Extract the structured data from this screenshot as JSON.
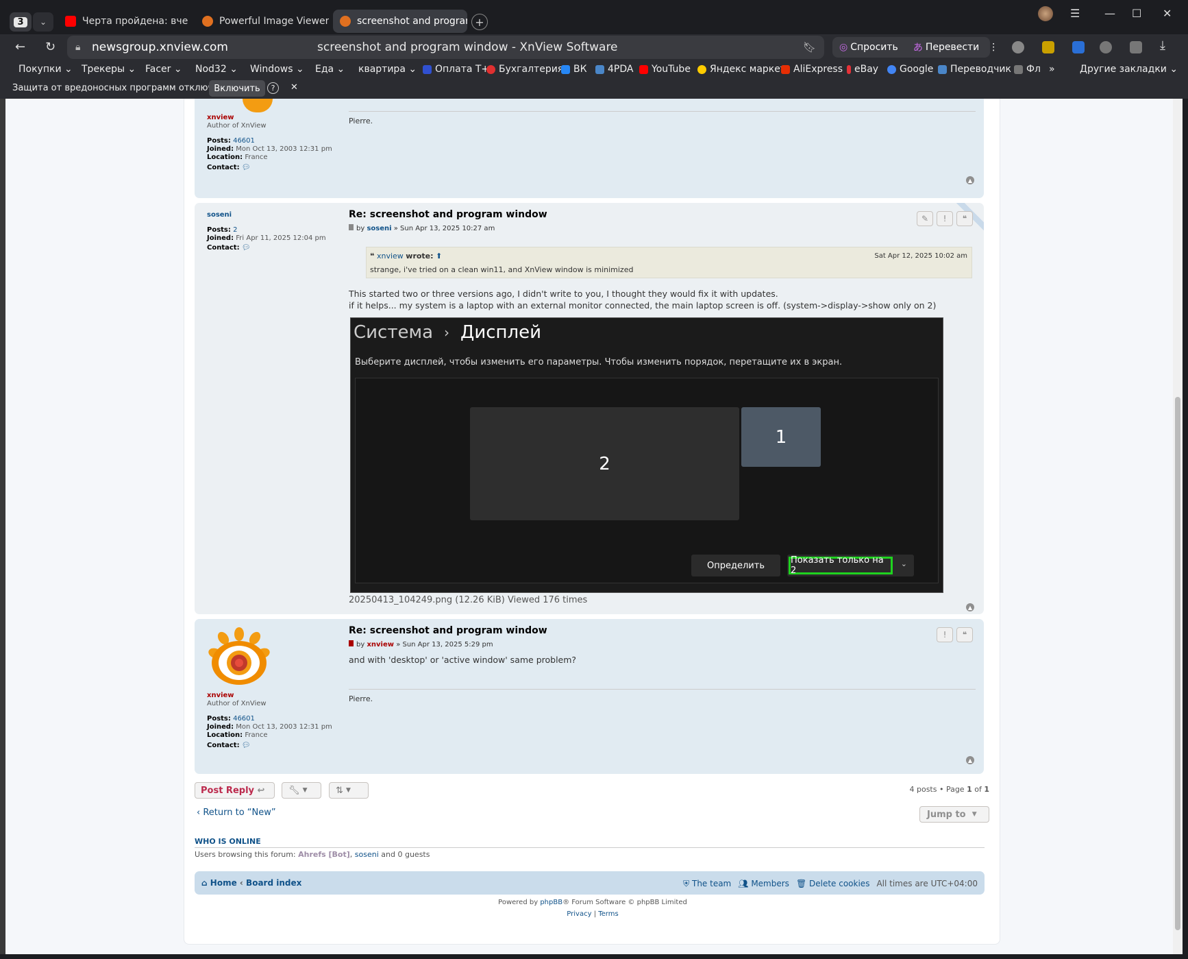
{
  "browser": {
    "tab_count": "3",
    "tabs": [
      {
        "title": "Черта пройдена: вчера С",
        "color": "#ff0000"
      },
      {
        "title": "Powerful Image Viewer· Xr",
        "color": "#e07020"
      },
      {
        "title": "screenshot and program",
        "color": "#e07020"
      }
    ],
    "url": "newsgroup.xnview.com",
    "page_title": "screenshot and program window - XnView Software",
    "ask_label": "Спросить",
    "translate_label": "Перевести",
    "bookmarks": [
      "Покупки",
      "Трекеры",
      "Facer",
      "Nod32",
      "Windows",
      "Еда",
      "квартира",
      "Оплата Т+",
      "Бухгалтерия",
      "ВК",
      "4PDA",
      "YouTube",
      "Яндекс маркет",
      "AliExpress",
      "eBay",
      "Google",
      "Переводчик",
      "Фл",
      "Другие закладки"
    ],
    "warning_text": "Защита от вредоносных программ отключена",
    "warning_button": "Включить"
  },
  "post0": {
    "username": "xnview",
    "rank": "Author of XnView",
    "posts_label": "Posts:",
    "posts": "46601",
    "joined_label": "Joined:",
    "joined": "Mon Oct 13, 2003 12:31 pm",
    "location_label": "Location:",
    "location": "France",
    "contact_label": "Contact:",
    "signature": "Pierre."
  },
  "post1": {
    "username": "soseni",
    "posts_label": "Posts:",
    "posts": "2",
    "joined_label": "Joined:",
    "joined": "Fri Apr 11, 2025 12:04 pm",
    "contact_label": "Contact:",
    "title": "Re: screenshot and program window",
    "by": "by",
    "author": "soseni",
    "date": "» Sun Apr 13, 2025 10:27 am",
    "quote_user": "xnview",
    "quote_wrote": "wrote:",
    "quote_date": "Sat Apr 12, 2025 10:02 am",
    "quote_text": "strange, i've tried on a clean win11, and XnView window is minimized",
    "body_line1": "This started two or three versions ago, I didn't write to you, I thought they would fix it with updates.",
    "body_line2": "if it helps... my system is a laptop with an external monitor connected, the main laptop screen is off. (system->display->show only on 2)",
    "attachment_caption": "20250413_104249.png (12.26 KiB) Viewed 176 times",
    "shot": {
      "crumb1": "Система",
      "crumb_sep": "›",
      "crumb2": "Дисплей",
      "hint": "Выберите дисплей, чтобы изменить его параметры. Чтобы изменить порядок, перетащите их в экран.",
      "monitor_big": "2",
      "monitor_small": "1",
      "identify": "Определить",
      "show_only": "Показать только на 2"
    }
  },
  "post2": {
    "username": "xnview",
    "rank": "Author of XnView",
    "posts_label": "Posts:",
    "posts": "46601",
    "joined_label": "Joined:",
    "joined": "Mon Oct 13, 2003 12:31 pm",
    "location_label": "Location:",
    "location": "France",
    "contact_label": "Contact:",
    "title": "Re: screenshot and program window",
    "by": "by",
    "author": "xnview",
    "date": "» Sun Apr 13, 2025 5:29 pm",
    "body": "and with 'desktop' or 'active window' same problem?",
    "signature": "Pierre."
  },
  "actions": {
    "post_reply": "Post Reply",
    "pagination": "4 posts • Page",
    "page_current": "1",
    "page_of": "of",
    "page_total": "1",
    "return_link": "Return to “New”",
    "jump_to": "Jump to"
  },
  "online": {
    "heading": "WHO IS ONLINE",
    "text_prefix": "Users browsing this forum:",
    "bot": "Ahrefs [Bot]",
    "user": "soseni",
    "text_suffix": "and 0 guests"
  },
  "footer_nav": {
    "home": "Home",
    "board_index": "Board index",
    "team": "The team",
    "members": "Members",
    "delete_cookies": "Delete cookies",
    "timezone_label": "All times are",
    "timezone": "UTC+04:00"
  },
  "footer": {
    "powered_prefix": "Powered by",
    "phpbb": "phpBB",
    "powered_suffix": "® Forum Software © phpBB Limited",
    "privacy": "Privacy",
    "sep": "|",
    "terms": "Terms"
  }
}
